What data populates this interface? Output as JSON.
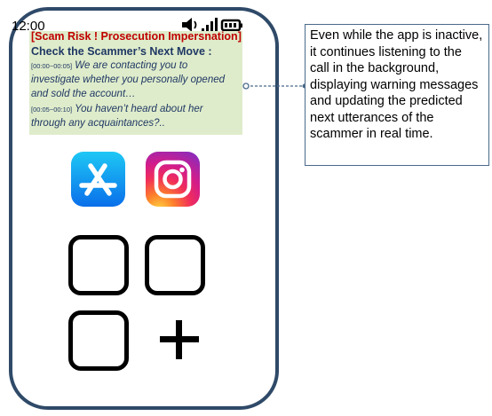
{
  "status_bar": {
    "time": "12:00",
    "icons": [
      "speaker-icon",
      "signal-icon",
      "battery-icon"
    ]
  },
  "warning_banner": {
    "alert_title": "[Scam Risk ! Prosecution Impersnation]",
    "heading": "Check the Scammer’s Next Move :",
    "utterances": [
      {
        "timestamp": "[00:00~00:05]",
        "lines": [
          "We are contacting you to",
          "investigate whether you personally opened",
          "and sold the account…"
        ]
      },
      {
        "timestamp": "[00:05~00:10]",
        "lines": [
          "You haven’t heard about her",
          "through any acquaintances?.."
        ]
      }
    ]
  },
  "apps": [
    "app-store-icon",
    "instagram-icon"
  ],
  "callout": {
    "text": "Even while the app is inactive, it continues listening to the call in the background, displaying warning messages and updating the predicted next utterances of the scammer in real time."
  },
  "colors": {
    "phone_border": "#2f4a68",
    "banner_bg": "#dfeccb",
    "alert": "#c00000",
    "banner_text": "#1f3864"
  }
}
